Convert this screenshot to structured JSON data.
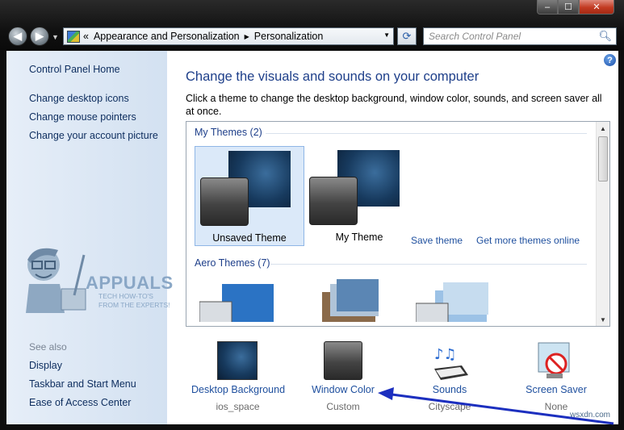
{
  "window": {
    "controls": {
      "minimize": "–",
      "maximize": "☐",
      "close": "✕"
    }
  },
  "nav": {
    "back": "◀",
    "forward": "▶",
    "dropdown": "▼"
  },
  "address": {
    "prefix": "«",
    "crumbs": [
      "Appearance and Personalization",
      "Personalization"
    ],
    "separator": "▶",
    "dropdown": "▼"
  },
  "refresh_symbol": "⟳",
  "search": {
    "placeholder": "Search Control Panel",
    "icon": "search-icon"
  },
  "sidebar": {
    "home": "Control Panel Home",
    "links": [
      "Change desktop icons",
      "Change mouse pointers",
      "Change your account picture"
    ],
    "see_also_label": "See also",
    "see_also_links": [
      "Display",
      "Taskbar and Start Menu",
      "Ease of Access Center"
    ]
  },
  "logo": {
    "brand": "APPUALS",
    "tagline": "TECH HOW-TO'S FROM THE EXPERTS!"
  },
  "main": {
    "help": "?",
    "title": "Change the visuals and sounds on your computer",
    "description": "Click a theme to change the desktop background, window color, sounds, and screen saver all at once.",
    "my_themes_label": "My Themes (2)",
    "themes": [
      {
        "name": "Unsaved Theme",
        "selected": true
      },
      {
        "name": "My Theme",
        "selected": false
      }
    ],
    "save_theme": "Save theme",
    "get_more": "Get more themes online",
    "aero_label": "Aero Themes (7)"
  },
  "bottom": [
    {
      "label": "Desktop Background",
      "sub": "ios_space",
      "icon": "desktop-background-icon"
    },
    {
      "label": "Window Color",
      "sub": "Custom",
      "icon": "window-color-icon"
    },
    {
      "label": "Sounds",
      "sub": "Cityscape",
      "icon": "sounds-icon"
    },
    {
      "label": "Screen Saver",
      "sub": "None",
      "icon": "screen-saver-icon"
    }
  ],
  "watermark": "wsxdn.com",
  "colors": {
    "link": "#1e4f9e",
    "title": "#1e3f8a",
    "sidebar_bg": "#dce7f4",
    "arrow": "#1c2fbf"
  }
}
